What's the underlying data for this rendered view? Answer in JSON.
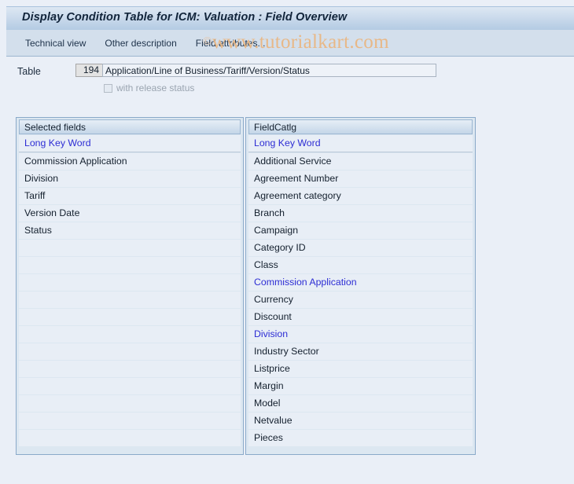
{
  "window": {
    "title": "Display Condition Table for ICM: Valuation : Field Overview"
  },
  "toolbar": {
    "buttons": [
      {
        "label": "Technical view",
        "name": "technical-view-button"
      },
      {
        "label": "Other description",
        "name": "other-description-button"
      },
      {
        "label": "Field attributes...",
        "name": "field-attributes-button"
      }
    ]
  },
  "watermark": {
    "copyright": "©",
    "text": "www.tutorialkart.com",
    "color": "#e8b887"
  },
  "form": {
    "table_label": "Table",
    "table_number": "194",
    "table_description": "Application/Line of Business/Tariff/Version/Status",
    "release_status_label": "with release status",
    "release_status_checked": false
  },
  "panels": {
    "selected_fields": {
      "header": "Selected fields",
      "rows": [
        {
          "label": "Long Key Word",
          "highlight": true,
          "divider": true
        },
        {
          "label": "Commission Application",
          "highlight": false
        },
        {
          "label": "Division",
          "highlight": false
        },
        {
          "label": "Tariff",
          "highlight": false
        },
        {
          "label": "Version Date",
          "highlight": false
        },
        {
          "label": "Status",
          "highlight": false
        },
        {
          "label": "",
          "highlight": false
        },
        {
          "label": "",
          "highlight": false
        },
        {
          "label": "",
          "highlight": false
        },
        {
          "label": "",
          "highlight": false
        },
        {
          "label": "",
          "highlight": false
        },
        {
          "label": "",
          "highlight": false
        },
        {
          "label": "",
          "highlight": false
        },
        {
          "label": "",
          "highlight": false
        },
        {
          "label": "",
          "highlight": false
        },
        {
          "label": "",
          "highlight": false
        },
        {
          "label": "",
          "highlight": false
        },
        {
          "label": "",
          "highlight": false
        }
      ]
    },
    "field_catalog": {
      "header": "FieldCatlg",
      "rows": [
        {
          "label": "Long Key Word",
          "highlight": true,
          "divider": true
        },
        {
          "label": "Additional Service",
          "highlight": false
        },
        {
          "label": "Agreement Number",
          "highlight": false
        },
        {
          "label": "Agreement category",
          "highlight": false
        },
        {
          "label": "Branch",
          "highlight": false
        },
        {
          "label": "Campaign",
          "highlight": false
        },
        {
          "label": "Category ID",
          "highlight": false
        },
        {
          "label": "Class",
          "highlight": false
        },
        {
          "label": "Commission Application",
          "highlight": true
        },
        {
          "label": "Currency",
          "highlight": false
        },
        {
          "label": "Discount",
          "highlight": false
        },
        {
          "label": "Division",
          "highlight": true
        },
        {
          "label": "Industry Sector",
          "highlight": false
        },
        {
          "label": "Listprice",
          "highlight": false
        },
        {
          "label": "Margin",
          "highlight": false
        },
        {
          "label": "Model",
          "highlight": false
        },
        {
          "label": "Netvalue",
          "highlight": false
        },
        {
          "label": "Pieces",
          "highlight": false
        }
      ]
    }
  },
  "colors": {
    "background": "#eaeff7",
    "title_bar": "#b4cbe3",
    "toolbar": "#d3dfec",
    "panel_border": "#8aa9c9",
    "row_background": "#e8eef6",
    "highlight_text": "#2d2dd4",
    "normal_text": "#14202e"
  }
}
